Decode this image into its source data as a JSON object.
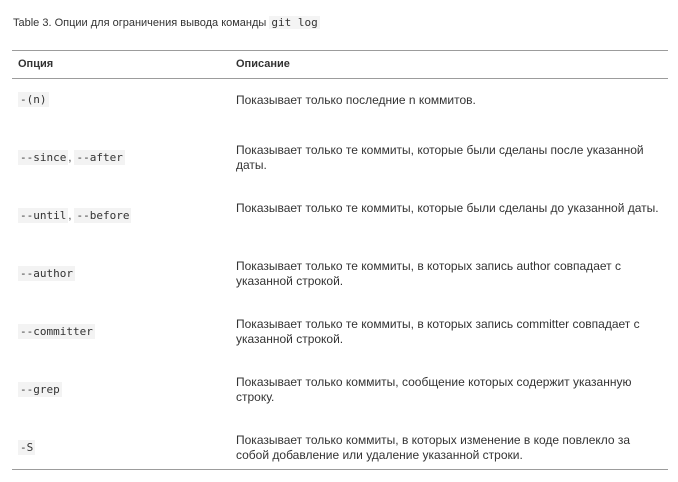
{
  "caption": {
    "prefix": "Table 3. Опции для ограничения вывода команды",
    "command": "git log"
  },
  "table": {
    "headers": [
      "Опция",
      "Описание"
    ],
    "rows": [
      {
        "options": [
          "-(n)"
        ],
        "description": "Показывает только последние n коммитов."
      },
      {
        "options": [
          "--since",
          "--after"
        ],
        "description": "Показывает только те коммиты, которые были сделаны после указанной даты."
      },
      {
        "options": [
          "--until",
          "--before"
        ],
        "description": "Показывает только те коммиты, которые были сделаны до указанной даты."
      },
      {
        "options": [
          "--author"
        ],
        "description": "Показывает только те коммиты, в которых запись author совпадает с указанной строкой."
      },
      {
        "options": [
          "--committer"
        ],
        "description": "Показывает только те коммиты, в которых запись committer совпадает с указанной строкой."
      },
      {
        "options": [
          "--grep"
        ],
        "description": "Показывает только коммиты, сообщение которых содержит указанную строку."
      },
      {
        "options": [
          "-S"
        ],
        "description": "Показывает только коммиты, в которых изменение в коде повлекло за собой добавление или удаление указанной строки."
      }
    ]
  }
}
